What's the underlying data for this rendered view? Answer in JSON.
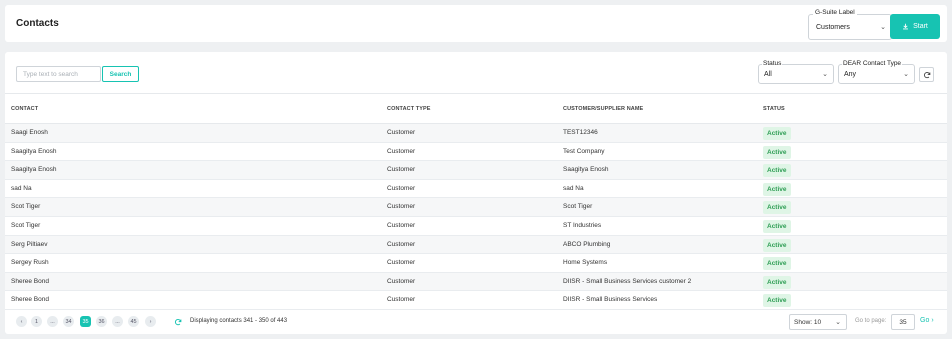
{
  "header": {
    "title": "Contacts",
    "gsuite": {
      "label": "G-Suite Label",
      "value": "Customers"
    },
    "start_label": "Start"
  },
  "toolbar": {
    "search_placeholder": "Type text to search",
    "search_label": "Search",
    "status": {
      "label": "Status",
      "value": "All"
    },
    "dear_type": {
      "label": "DEAR Contact Type",
      "value": "Any"
    }
  },
  "table": {
    "columns": [
      "CONTACT",
      "CONTACT TYPE",
      "CUSTOMER/SUPPLIER NAME",
      "STATUS"
    ],
    "rows": [
      {
        "contact": "Saagi Enosh",
        "type": "Customer",
        "name": "TEST12346",
        "status": "Active"
      },
      {
        "contact": "Saagitya Enosh",
        "type": "Customer",
        "name": "Test Company",
        "status": "Active"
      },
      {
        "contact": "Saagitya Enosh",
        "type": "Customer",
        "name": "Saagitya Enosh",
        "status": "Active"
      },
      {
        "contact": "sad Na",
        "type": "Customer",
        "name": "sad Na",
        "status": "Active"
      },
      {
        "contact": "Scot Tiger",
        "type": "Customer",
        "name": "Scot Tiger",
        "status": "Active"
      },
      {
        "contact": "Scot Tiger",
        "type": "Customer",
        "name": "ST Industries",
        "status": "Active"
      },
      {
        "contact": "Serg Piltiaev",
        "type": "Customer",
        "name": "ABCO Plumbing",
        "status": "Active"
      },
      {
        "contact": "Sergey Rush",
        "type": "Customer",
        "name": "Home Systems",
        "status": "Active"
      },
      {
        "contact": "Sheree Bond",
        "type": "Customer",
        "name": "DIISR - Small Business Services customer 2",
        "status": "Active"
      },
      {
        "contact": "Sheree Bond",
        "type": "Customer",
        "name": "DIISR - Small Business Services",
        "status": "Active"
      }
    ]
  },
  "pagination": {
    "prev": "‹",
    "next": "›",
    "pages": [
      "1",
      "...",
      "34",
      "35",
      "36",
      "...",
      "45"
    ],
    "current": "35",
    "display_text": "Displaying contacts 341 - 350 of 443",
    "show_label": "Show: 10",
    "goto_label": "Go to page:",
    "goto_value": "35",
    "go_label": "Go"
  },
  "colors": {
    "accent": "#17c3b2",
    "active_bg": "#dff5e6",
    "active_text": "#2f9e55"
  }
}
